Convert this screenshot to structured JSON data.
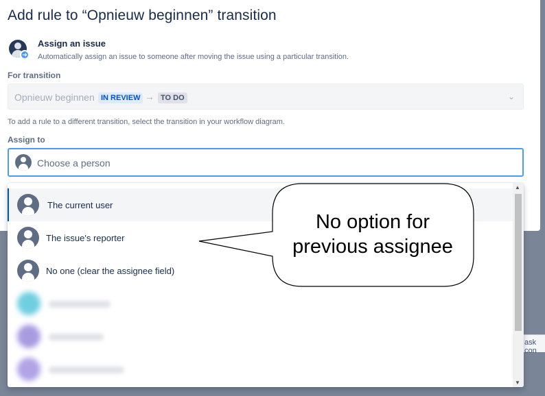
{
  "modal": {
    "title": "Add rule to “Opnieuw beginnen” transition",
    "rule": {
      "icon": "assign-user-icon",
      "name": "Assign an issue",
      "description": "Automatically assign an issue to someone after moving the issue using a particular transition."
    },
    "for_transition": {
      "label": "For transition",
      "transition_name": "Opnieuw beginnen",
      "from_status": "IN REVIEW",
      "to_status": "TO DO",
      "arrow_glyph": "→",
      "chevron_glyph": "⌄"
    },
    "helper_text": "To add a rule to a different transition, select the transition in your workflow diagram.",
    "assign_to": {
      "label": "Assign to",
      "placeholder": "Choose a person"
    }
  },
  "dropdown": {
    "options": [
      {
        "label": "The current user"
      },
      {
        "label": "The issue's reporter"
      },
      {
        "label": "No one (clear the assignee field)"
      }
    ]
  },
  "background": {
    "partial_text": "ask con"
  },
  "callout": {
    "line1": "No option for",
    "line2": "previous assignee"
  },
  "colors": {
    "primary": "#0052cc",
    "focus_border": "#4c9aff",
    "text": "#172b4d",
    "subtle_text": "#5e6c84"
  }
}
